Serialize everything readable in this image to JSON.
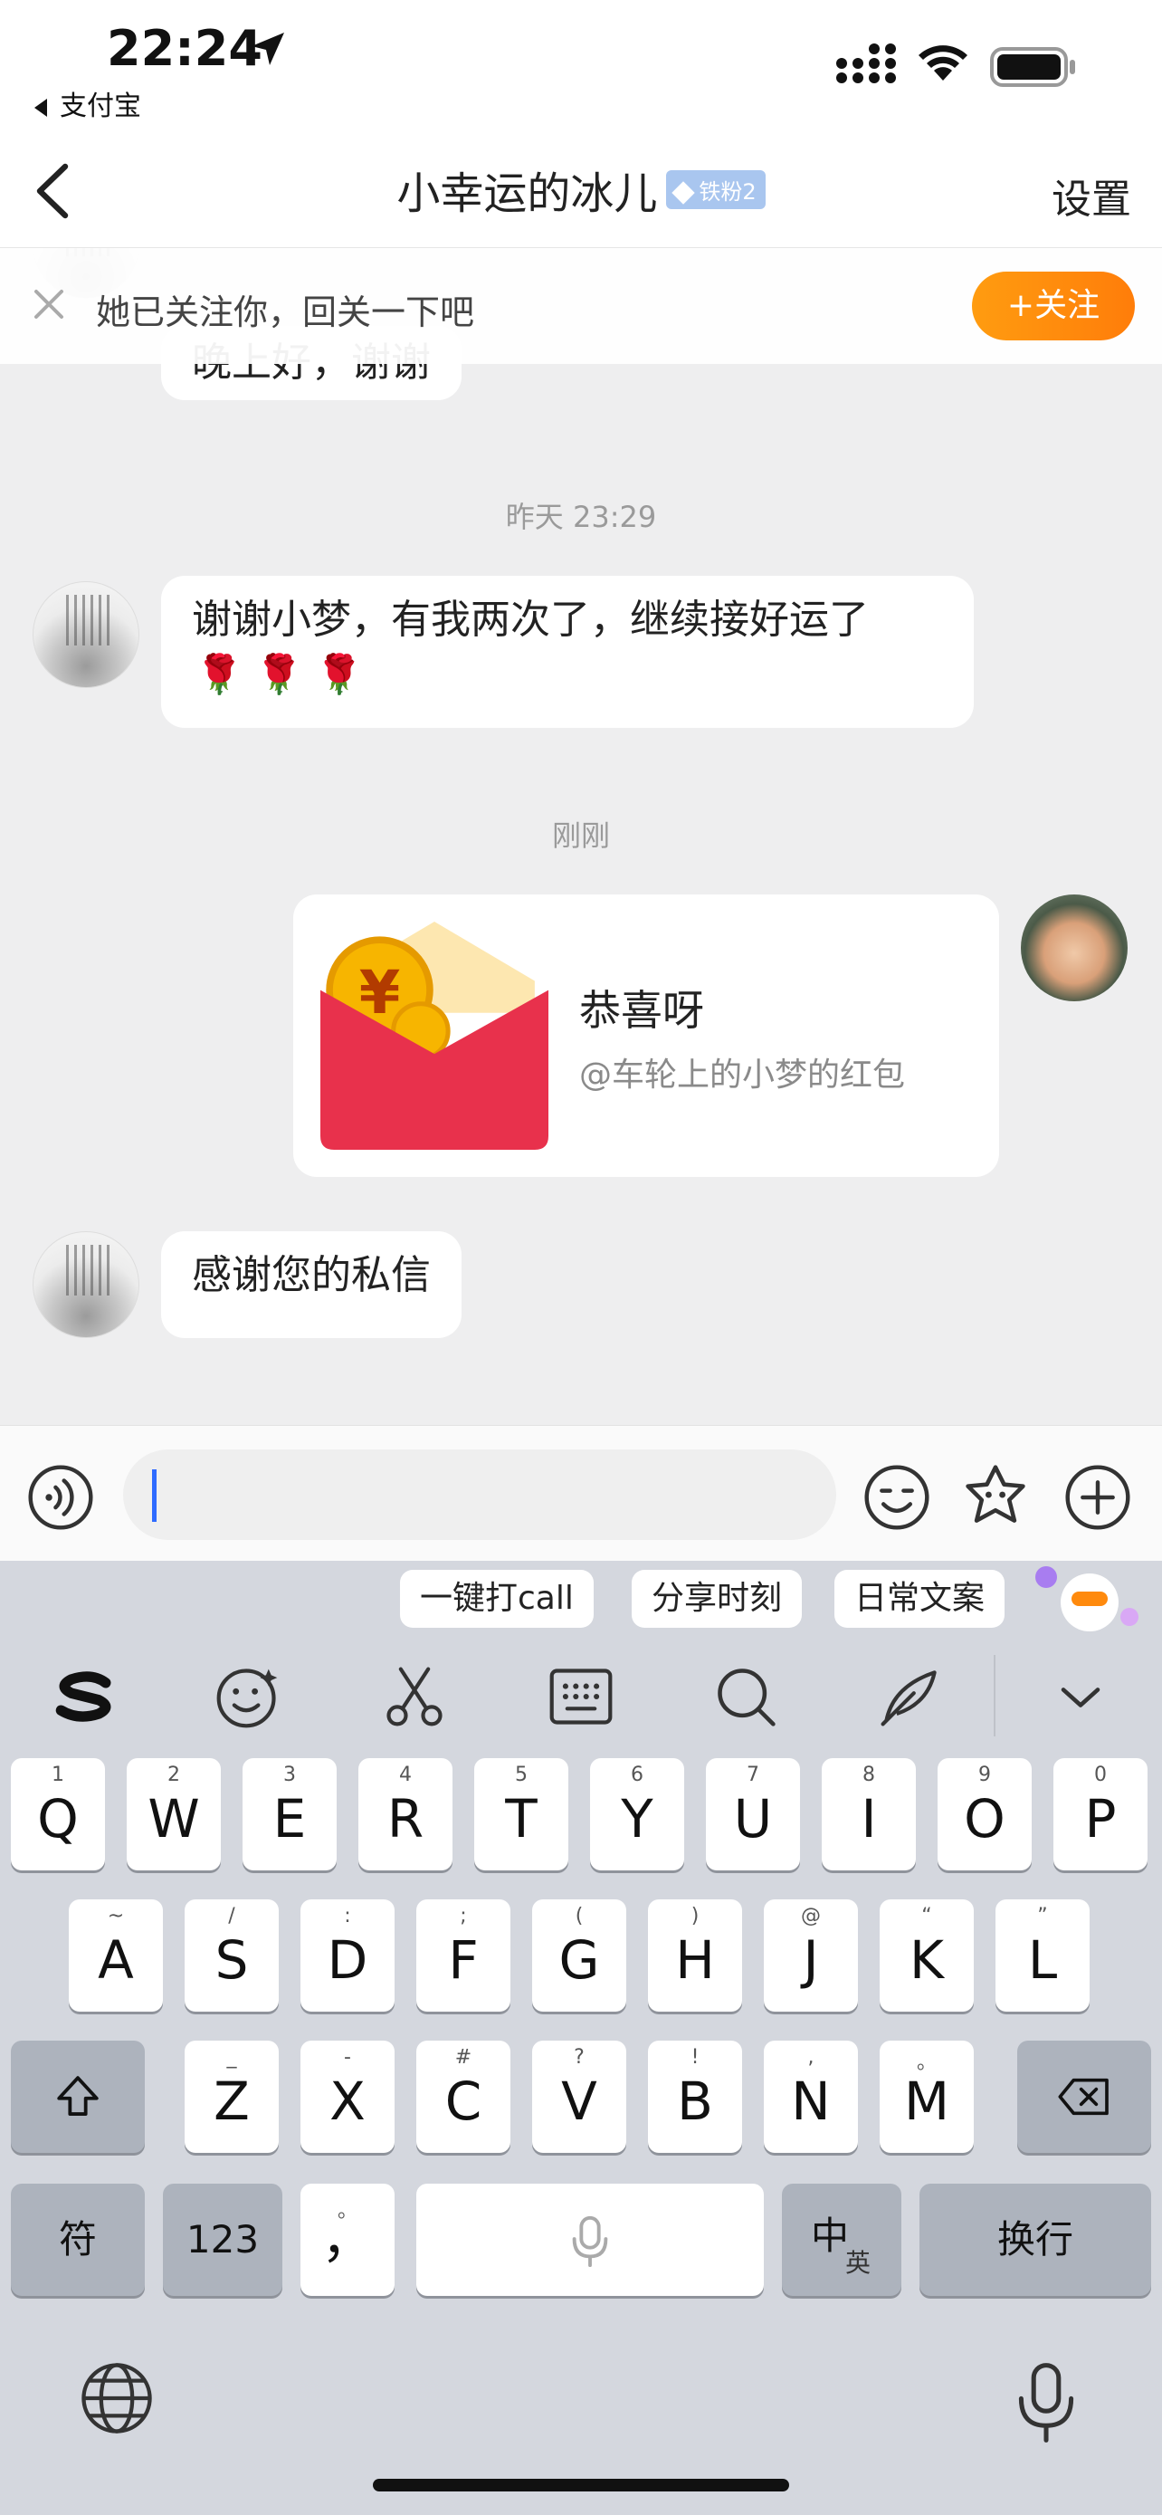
{
  "status_bar": {
    "time": "22:24",
    "back_app": "支付宝"
  },
  "nav": {
    "title": "小幸运的冰儿",
    "fan_badge": "铁粉2",
    "settings": "设置"
  },
  "follow_prompt": {
    "text": "她已关注你，回关一下吧",
    "button": "+关注"
  },
  "messages": {
    "partial_text": "晚上好，谢谢",
    "ts1": "昨天 23:29",
    "msg1_text": "谢谢小梦，有我两次了，继续接好运了",
    "msg1_emoji": "🌹🌹🌹",
    "ts2": "刚刚",
    "red_packet": {
      "title": "恭喜呀",
      "subtitle": "@车轮上的小梦的红包"
    },
    "msg2_text": "感谢您的私信"
  },
  "input": {
    "placeholder": ""
  },
  "keyboard": {
    "suggestions": [
      "一键打call",
      "分享时刻",
      "日常文案"
    ],
    "row1": [
      {
        "k": "Q",
        "h": "1"
      },
      {
        "k": "W",
        "h": "2"
      },
      {
        "k": "E",
        "h": "3"
      },
      {
        "k": "R",
        "h": "4"
      },
      {
        "k": "T",
        "h": "5"
      },
      {
        "k": "Y",
        "h": "6"
      },
      {
        "k": "U",
        "h": "7"
      },
      {
        "k": "I",
        "h": "8"
      },
      {
        "k": "O",
        "h": "9"
      },
      {
        "k": "P",
        "h": "0"
      }
    ],
    "row2": [
      {
        "k": "A",
        "h": "~"
      },
      {
        "k": "S",
        "h": "/"
      },
      {
        "k": "D",
        "h": ":"
      },
      {
        "k": "F",
        "h": ";"
      },
      {
        "k": "G",
        "h": "("
      },
      {
        "k": "H",
        "h": ")"
      },
      {
        "k": "J",
        "h": "@"
      },
      {
        "k": "K",
        "h": "“"
      },
      {
        "k": "L",
        "h": "”"
      }
    ],
    "row3": [
      {
        "k": "Z",
        "h": "_"
      },
      {
        "k": "X",
        "h": "-"
      },
      {
        "k": "C",
        "h": "#"
      },
      {
        "k": "V",
        "h": "?"
      },
      {
        "k": "B",
        "h": "!"
      },
      {
        "k": "N",
        "h": ","
      },
      {
        "k": "M",
        "h": "。"
      }
    ],
    "symbol_key": "符",
    "num_key": "123",
    "punct_key": "，",
    "punct_hint": "。",
    "lang_key_main": "中",
    "lang_key_sub": "英",
    "return_key": "换行"
  },
  "colors": {
    "accent": "#ff8a0d",
    "badge": "#a9c6ef",
    "caret": "#2f6bff",
    "red_packet": "#e8314c"
  }
}
